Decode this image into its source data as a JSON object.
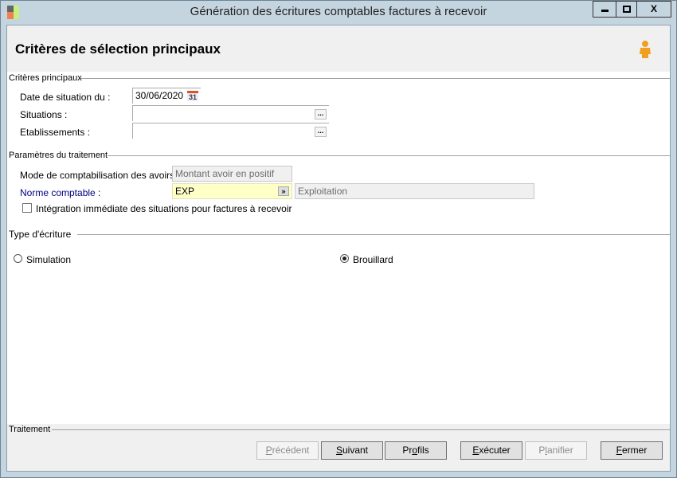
{
  "window": {
    "title": "Génération des écritures comptables factures à recevoir",
    "minimize": "▬",
    "maximize": "☐",
    "close": "X"
  },
  "header": {
    "title": "Critères de sélection principaux"
  },
  "criteres": {
    "section": "Critères principaux",
    "date_label": "Date de situation du :",
    "date_value": "30/06/2020",
    "calendar_day": "31",
    "situations_label": "Situations :",
    "situations_value": "",
    "etablissements_label": "Etablissements :",
    "etablissements_value": "",
    "browse": "..."
  },
  "parametres": {
    "section": "Paramètres du traitement",
    "mode_label": "Mode de comptabilisation des avoirs :",
    "mode_value": "Montant avoir en positif",
    "norme_label": "Norme comptable :",
    "norme_value": "EXP",
    "norme_desc": "Exploitation",
    "integration_label": "Intégration immédiate des situations pour factures à recevoir",
    "integration_checked": false
  },
  "type_ecriture": {
    "section": "Type d'écriture",
    "simulation": "Simulation",
    "brouillard": "Brouillard",
    "selected": "Brouillard"
  },
  "traitement": {
    "section": "Traitement"
  },
  "buttons": [
    {
      "pre": "",
      "key": "P",
      "post": "récédent",
      "enabled": false
    },
    {
      "pre": "",
      "key": "S",
      "post": "uivant",
      "enabled": true
    },
    {
      "pre": "Pr",
      "key": "o",
      "post": "fils",
      "enabled": true
    },
    {
      "pre": "",
      "key": "E",
      "post": "xécuter",
      "enabled": true
    },
    {
      "pre": "P",
      "key": "l",
      "post": "anifier",
      "enabled": false
    },
    {
      "pre": "",
      "key": "F",
      "post": "ermer",
      "enabled": true
    }
  ],
  "colors": {
    "norme_label": "#000080",
    "norme_bg": "#ffffc8",
    "accent": "#f0a020"
  }
}
